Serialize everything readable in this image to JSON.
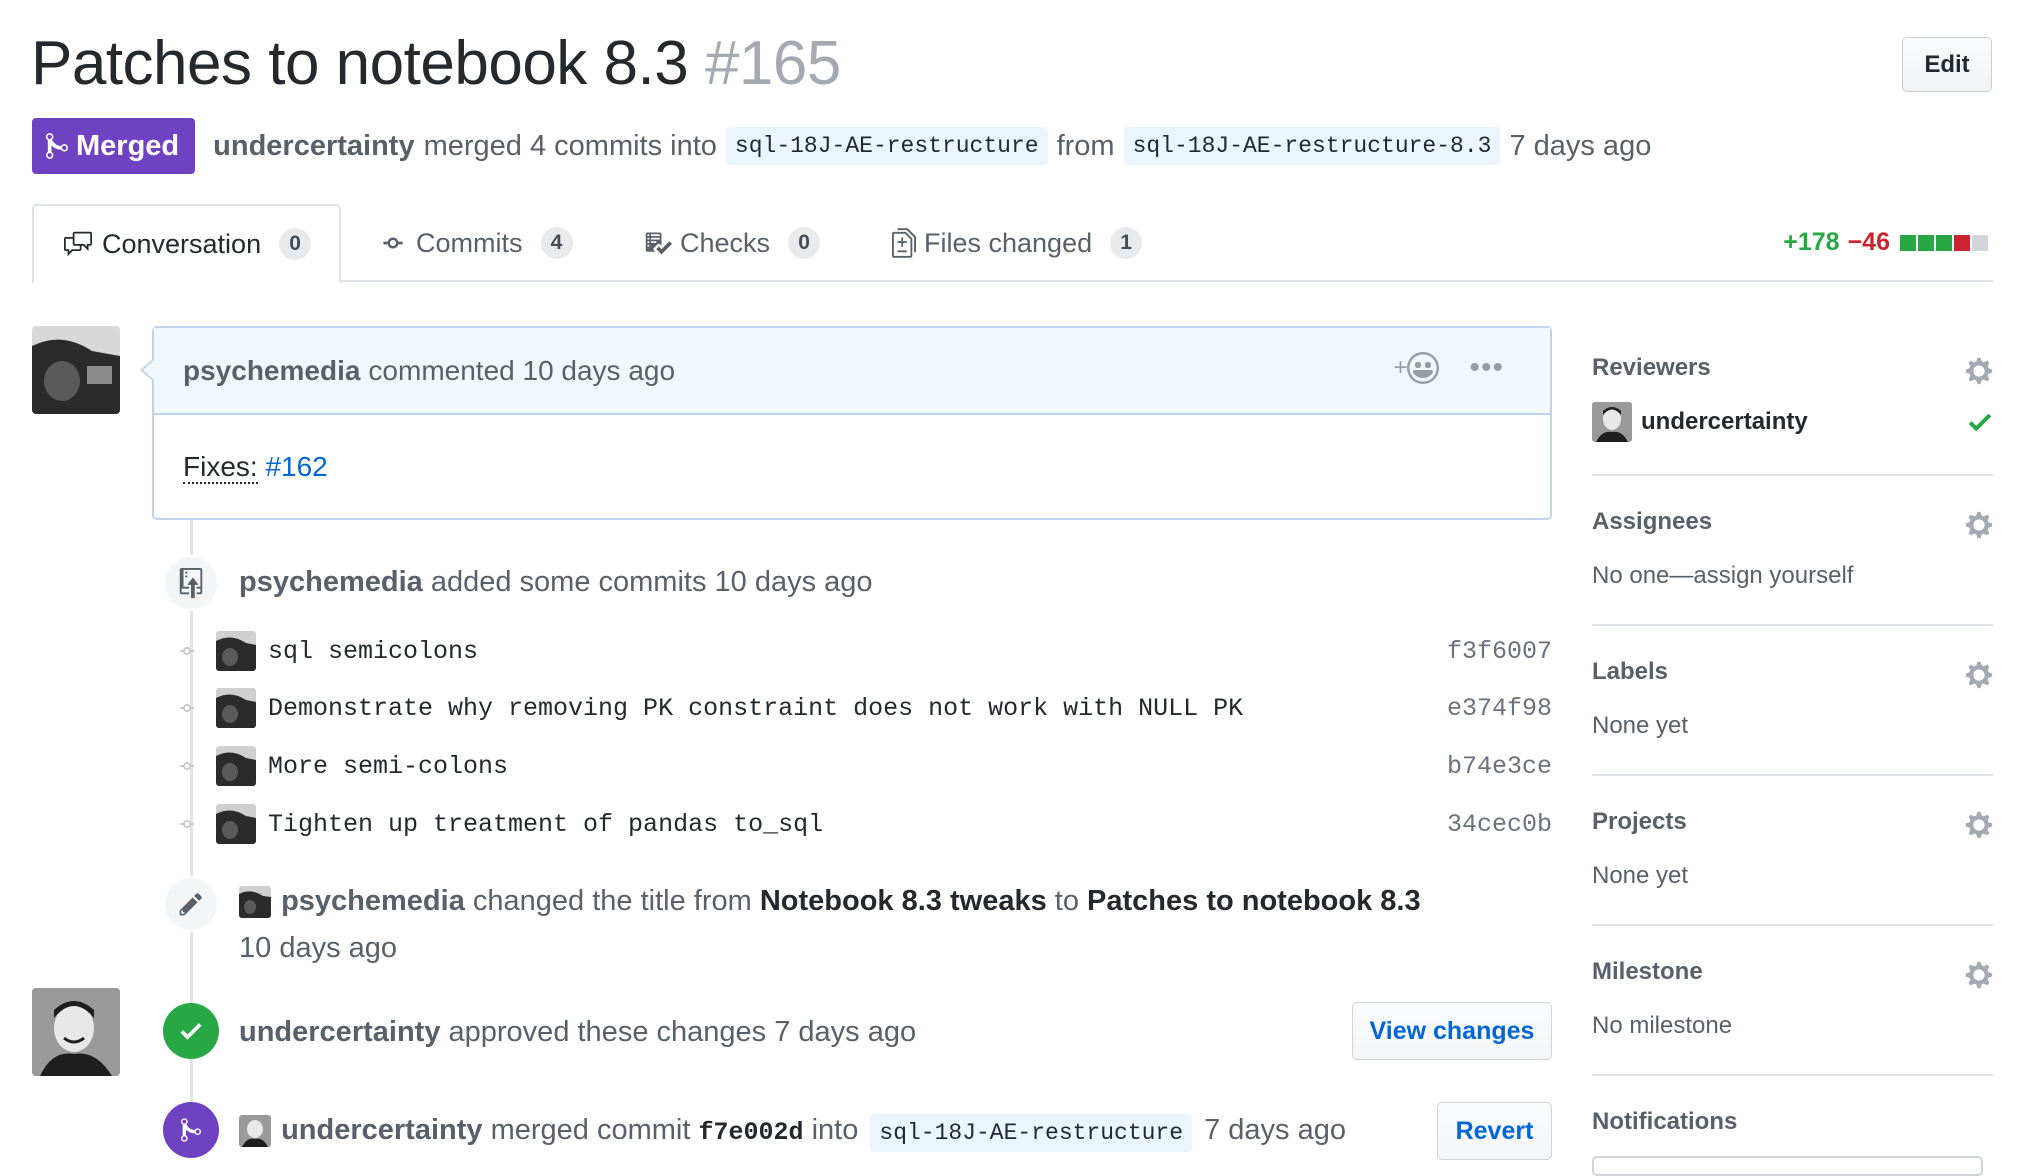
{
  "header": {
    "title": "Patches to notebook 8.3",
    "number": "#165",
    "edit_label": "Edit",
    "state_label": "Merged",
    "author": "undercertainty",
    "merged_text": "merged 4 commits into",
    "base_branch": "sql-18J-AE-restructure",
    "from_text": "from",
    "head_branch": "sql-18J-AE-restructure-8.3",
    "time": "7 days ago"
  },
  "tabs": [
    {
      "label": "Conversation",
      "count": "0",
      "icon": "comment-discussion-icon"
    },
    {
      "label": "Commits",
      "count": "4",
      "icon": "git-commit-icon"
    },
    {
      "label": "Checks",
      "count": "0",
      "icon": "checklist-icon"
    },
    {
      "label": "Files changed",
      "count": "1",
      "icon": "file-diff-icon"
    }
  ],
  "diffstat": {
    "additions": "+178",
    "deletions": "−46",
    "colors": [
      "#28a745",
      "#28a745",
      "#28a745",
      "#cb2431",
      "#d1d5da"
    ]
  },
  "comment": {
    "author": "psychemedia",
    "meta": "commented 10 days ago",
    "body_label": "Fixes:",
    "body_link": "#162",
    "reaction_icon": "smiley-icon",
    "more_icon": "kebab-horizontal-icon"
  },
  "commits_event": {
    "author": "psychemedia",
    "text": "added some commits 10 days ago",
    "commits": [
      {
        "message": "sql semicolons",
        "sha": "f3f6007"
      },
      {
        "message": "Demonstrate why removing PK constraint does not work with NULL PK",
        "sha": "e374f98"
      },
      {
        "message": "More semi-colons",
        "sha": "b74e3ce"
      },
      {
        "message": "Tighten up treatment of pandas to_sql",
        "sha": "34cec0b"
      }
    ]
  },
  "rename_event": {
    "author": "psychemedia",
    "text1": "changed the title from",
    "old_title": "Notebook 8.3 tweaks",
    "to_text": "to",
    "new_title": "Patches to notebook 8.3",
    "time": "10 days ago"
  },
  "approve_event": {
    "author": "undercertainty",
    "text": "approved these changes 7 days ago",
    "button": "View changes"
  },
  "merge_event": {
    "author": "undercertainty",
    "text1": "merged commit",
    "sha": "f7e002d",
    "into_text": "into",
    "branch": "sql-18J-AE-restructure",
    "time": "7 days ago",
    "button": "Revert"
  },
  "sidebar": {
    "reviewers": {
      "title": "Reviewers",
      "name": "undercertainty"
    },
    "assignees": {
      "title": "Assignees",
      "value": "No one—assign yourself"
    },
    "labels": {
      "title": "Labels",
      "value": "None yet"
    },
    "projects": {
      "title": "Projects",
      "value": "None yet"
    },
    "milestone": {
      "title": "Milestone",
      "value": "No milestone"
    },
    "notifications": {
      "title": "Notifications"
    }
  }
}
